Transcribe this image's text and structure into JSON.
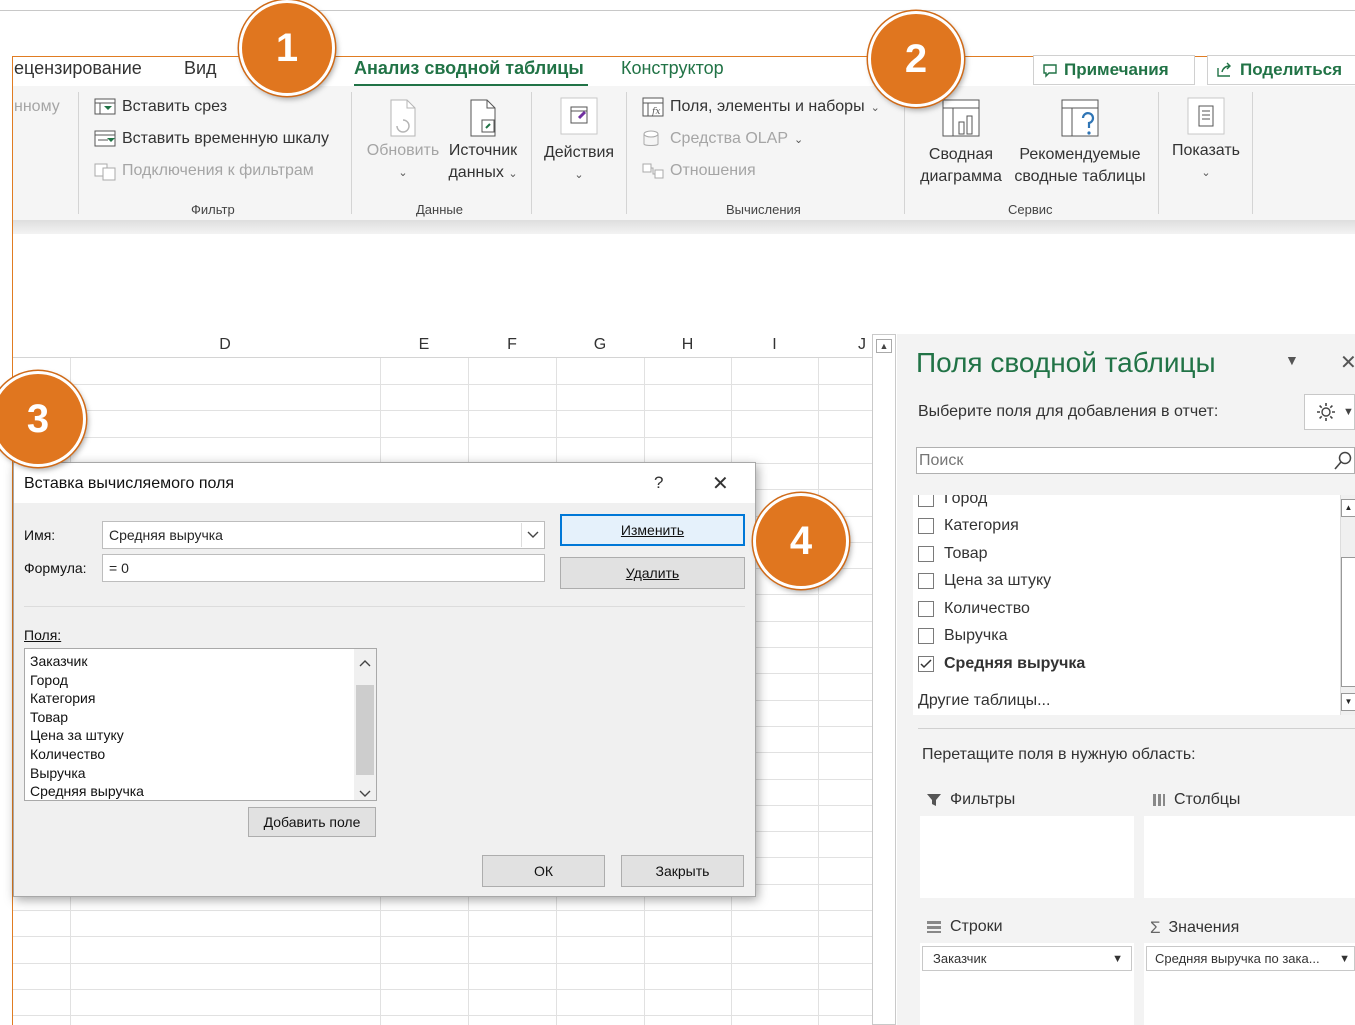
{
  "tabs": {
    "review": "ецензирование",
    "view": "Вид",
    "analyze": "Анализ сводной таблицы",
    "design": "Конструктор",
    "comments_btn": "Примечания",
    "share_btn": "Поделиться"
  },
  "ribbon": {
    "cut_left": "нному",
    "filter": {
      "insert_slicer": "Вставить срез",
      "insert_timeline": "Вставить временную шкалу",
      "filter_connections": "Подключения к фильтрам",
      "group_label": "Фильтр"
    },
    "data": {
      "refresh": "Обновить",
      "source_line1": "Источник",
      "source_line2": "данных",
      "group_label": "Данные"
    },
    "actions": {
      "label": "Действия"
    },
    "calc": {
      "fields_items": "Поля, элементы и наборы",
      "olap": "Средства OLAP",
      "relations": "Отношения",
      "group_label": "Вычисления"
    },
    "tools": {
      "chart_line1": "Сводная",
      "chart_line2": "диаграмма",
      "rec_line1": "Рекомендуемые",
      "rec_line2": "сводные таблицы",
      "group_label": "Сервис"
    },
    "show": {
      "label": "Показать"
    }
  },
  "grid": {
    "columns": [
      "D",
      "E",
      "F",
      "G",
      "H",
      "I",
      "J"
    ]
  },
  "dialog": {
    "title": "Вставка вычисляемого поля",
    "help": "?",
    "name_label": "Имя:",
    "name_value": "Средняя выручка",
    "formula_label": "Формула:",
    "formula_value": "= 0",
    "modify_btn": "Изменить",
    "delete_btn": "Удалить",
    "fields_label": "Поля:",
    "fields": [
      "Заказчик",
      "Город",
      "Категория",
      "Товар",
      "Цена за штуку",
      "Количество",
      "Выручка",
      "Средняя выручка"
    ],
    "add_field_btn": "Добавить поле",
    "ok_btn": "ОК",
    "close_btn": "Закрыть"
  },
  "pane": {
    "title": "Поля сводной таблицы",
    "subtitle": "Выберите поля для добавления в отчет:",
    "search_placeholder": "Поиск",
    "fields": [
      {
        "label": "Город",
        "checked": false
      },
      {
        "label": "Категория",
        "checked": false
      },
      {
        "label": "Товар",
        "checked": false
      },
      {
        "label": "Цена за штуку",
        "checked": false
      },
      {
        "label": "Количество",
        "checked": false
      },
      {
        "label": "Выручка",
        "checked": false
      },
      {
        "label": "Средняя выручка",
        "checked": true
      }
    ],
    "other_tables": "Другие таблицы...",
    "drag_hint": "Перетащите поля в нужную область:",
    "filters": "Фильтры",
    "columns": "Столбцы",
    "rows": "Строки",
    "values": "Значения",
    "rows_item": "Заказчик",
    "values_item": "Средняя выручка по зака..."
  },
  "badges": [
    "1",
    "2",
    "3",
    "4"
  ],
  "colors": {
    "accent_green": "#217346",
    "badge_orange": "#e0761f",
    "frame_orange": "#e07c22",
    "primary_blue": "#0078d7"
  }
}
